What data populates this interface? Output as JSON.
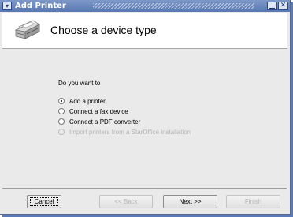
{
  "window": {
    "title": "Add Printer",
    "menu_glyph": "▾",
    "minimize_glyph": "▁",
    "close_glyph": "✕"
  },
  "header": {
    "title": "Choose a device type",
    "icon": "printer-icon"
  },
  "content": {
    "question": "Do you want to",
    "options": [
      {
        "label": "Add a printer",
        "checked": true,
        "enabled": true
      },
      {
        "label": "Connect a fax device",
        "checked": false,
        "enabled": true
      },
      {
        "label": "Connect a PDF converter",
        "checked": false,
        "enabled": true
      },
      {
        "label": "Import printers from a StarOffice installation",
        "checked": false,
        "enabled": false
      }
    ]
  },
  "buttons": {
    "cancel": "Cancel",
    "back": "<< Back",
    "next": "Next >>",
    "finish": "Finish"
  },
  "colors": {
    "titlebar": "#6a88c0",
    "dialog_bg": "#eaeaea",
    "disabled_text": "#b5b5b5"
  }
}
